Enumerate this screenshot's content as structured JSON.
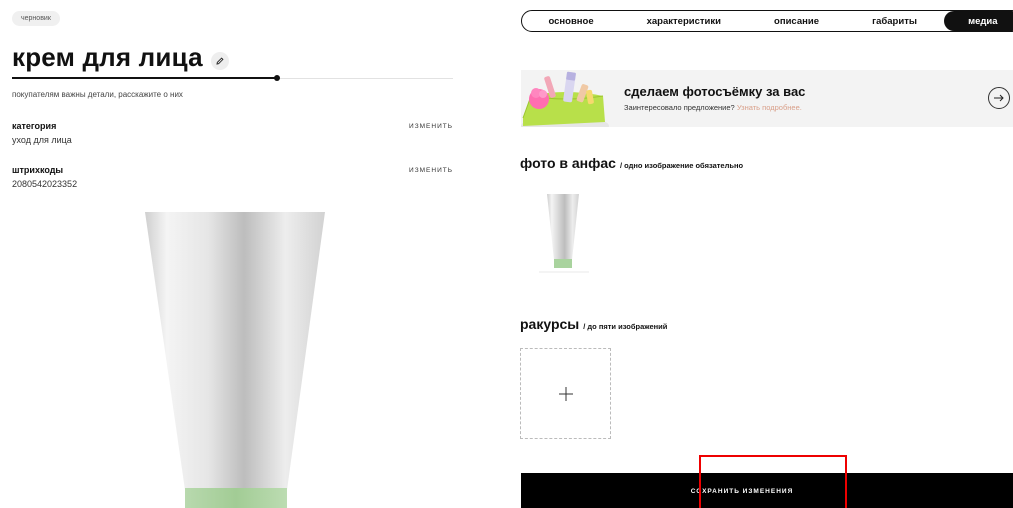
{
  "status_badge": "черновик",
  "product": {
    "title": "крем для лица",
    "hint": "покупателям важны детали, расскажите о них",
    "progress": 0.6
  },
  "fields": {
    "category": {
      "label": "категория",
      "change": "изменить",
      "value": "уход для лица"
    },
    "barcodes": {
      "label": "штрихкоды",
      "change": "изменить",
      "value": "2080542023352"
    }
  },
  "tabs": [
    {
      "label": "основное",
      "active": false
    },
    {
      "label": "характеристики",
      "active": false
    },
    {
      "label": "описание",
      "active": false
    },
    {
      "label": "габариты",
      "active": false
    },
    {
      "label": "медиа",
      "active": true
    }
  ],
  "promo": {
    "title": "сделаем фотосъёмку за вас",
    "text": "Заинтересовало предложение?",
    "link": "Узнать подробнее."
  },
  "sections": {
    "front": {
      "title": "фото в анфас",
      "note": "/ одно изображение обязательно"
    },
    "angles": {
      "title": "ракурсы",
      "note": "/ до пяти изображений"
    }
  },
  "save_button": "сохранить изменения",
  "icons": {
    "edit": "pencil-icon",
    "promo_arrow": "arrow-right-circle-icon",
    "add": "plus-icon"
  },
  "colors": {
    "accent": "#000000",
    "link": "#d9a08a",
    "highlight": "#ee0000",
    "tube_cap": "#a9d39e"
  }
}
